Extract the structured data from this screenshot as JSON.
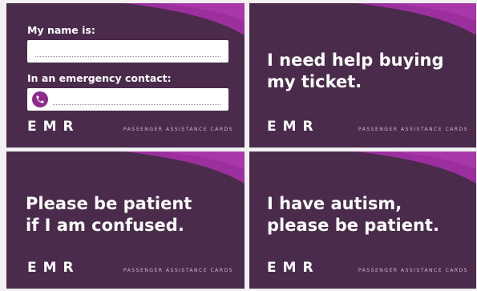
{
  "colors": {
    "card_background": "#4a2b4b",
    "accent": "#9b2f9d",
    "accent_dark": "#6a2a6d",
    "field_background": "#ffffff"
  },
  "brand": {
    "logo": "EMR",
    "tagline": "PASSENGER ASSISTANCE CARDS"
  },
  "cards": [
    {
      "name_label": "My name is:",
      "emergency_label": "In an emergency contact:",
      "icons": [
        "phone-icon"
      ]
    },
    {
      "message_line1": "I need help buying",
      "message_line2": "my ticket."
    },
    {
      "message_line1": "Please be patient",
      "message_line2": "if I am confused."
    },
    {
      "message_line1": "I have autism,",
      "message_line2": "please be patient."
    }
  ]
}
